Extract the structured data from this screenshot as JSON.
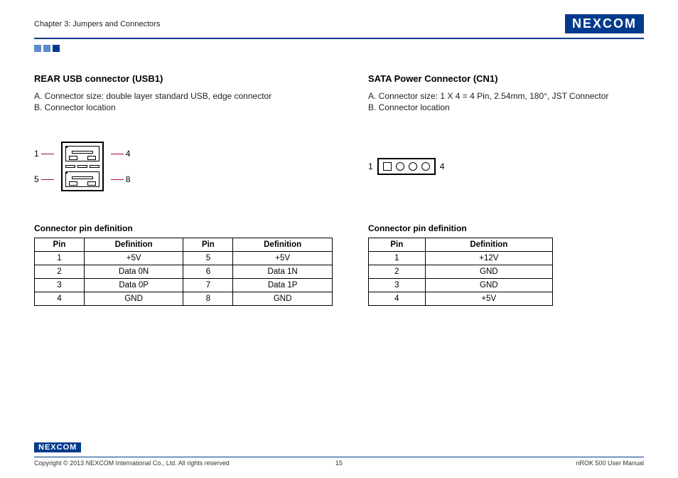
{
  "header": {
    "chapter": "Chapter 3: Jumpers and Connectors",
    "logo": "NEXCOM"
  },
  "left": {
    "title": "REAR USB connector (USB1)",
    "line_a": "A. Connector size: double layer standard USB, edge connector",
    "line_b": "B. Connector location",
    "diagram": {
      "p1": "1",
      "p4": "4",
      "p5": "5",
      "p8": "8"
    },
    "table_title": "Connector pin definition",
    "headers": {
      "pin": "Pin",
      "def": "Definition"
    },
    "rows": [
      {
        "p1": "1",
        "d1": "+5V",
        "p2": "5",
        "d2": "+5V"
      },
      {
        "p1": "2",
        "d1": "Data 0N",
        "p2": "6",
        "d2": "Data 1N"
      },
      {
        "p1": "3",
        "d1": "Data 0P",
        "p2": "7",
        "d2": "Data 1P"
      },
      {
        "p1": "4",
        "d1": "GND",
        "p2": "8",
        "d2": "GND"
      }
    ]
  },
  "right": {
    "title": "SATA Power Connector (CN1)",
    "line_a": "A. Connector size: 1 X 4 = 4 Pin, 2.54mm, 180°, JST Connector",
    "line_b": "B. Connector location",
    "diagram": {
      "p1": "1",
      "p4": "4"
    },
    "table_title": "Connector pin definition",
    "headers": {
      "pin": "Pin",
      "def": "Definition"
    },
    "rows": [
      {
        "p": "1",
        "d": "+12V"
      },
      {
        "p": "2",
        "d": "GND"
      },
      {
        "p": "3",
        "d": "GND"
      },
      {
        "p": "4",
        "d": "+5V"
      }
    ]
  },
  "footer": {
    "logo": "NEXCOM",
    "copyright": "Copyright © 2013 NEXCOM International Co., Ltd. All rights reserved",
    "page": "15",
    "manual": "nROK 500 User Manual"
  }
}
